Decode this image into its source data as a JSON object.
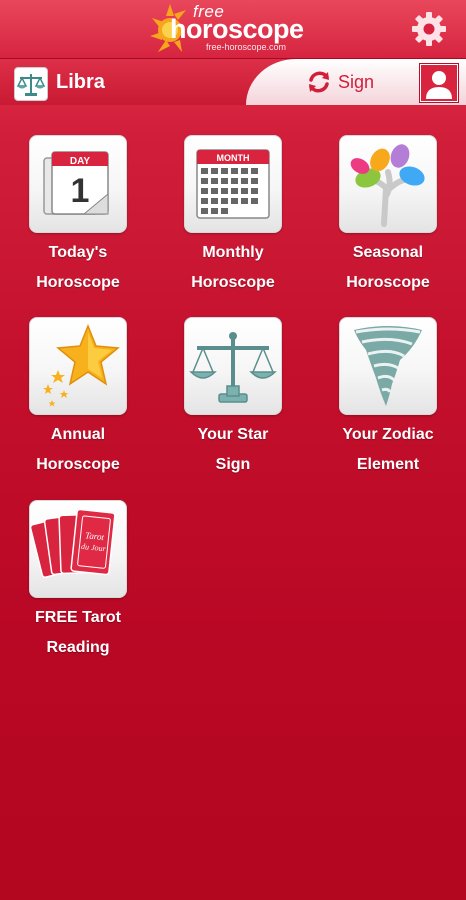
{
  "header": {
    "logo_free": "free",
    "logo_main": "horoscope",
    "logo_url": "free-horoscope.com",
    "settings_icon": "gear-icon"
  },
  "userbar": {
    "zodiac_name": "Libra",
    "zodiac_icon": "libra-scales-icon",
    "sign_label": "Sign",
    "sign_icon": "sync-icon",
    "avatar_icon": "user-avatar-icon"
  },
  "menu": [
    {
      "line1": "Today's",
      "line2": "Horoscope",
      "icon": "daily-calendar-icon"
    },
    {
      "line1": "Monthly",
      "line2": "Horoscope",
      "icon": "monthly-calendar-icon"
    },
    {
      "line1": "Seasonal",
      "line2": "Horoscope",
      "icon": "colorful-tree-icon"
    },
    {
      "line1": "Annual",
      "line2": "Horoscope",
      "icon": "shooting-star-icon"
    },
    {
      "line1": "Your Star",
      "line2": "Sign",
      "icon": "scales-icon"
    },
    {
      "line1": "Your Zodiac",
      "line2": "Element",
      "icon": "tornado-icon"
    },
    {
      "line1": "FREE Tarot",
      "line2": "Reading",
      "icon": "tarot-cards-icon"
    }
  ],
  "icon_text": {
    "day": "DAY",
    "month": "MONTH",
    "tarot_line1": "Tarot",
    "tarot_line2": "du Jour"
  },
  "colors": {
    "background": "#c4102c",
    "header": "#d62440",
    "accent_text": "#d11f3b"
  }
}
